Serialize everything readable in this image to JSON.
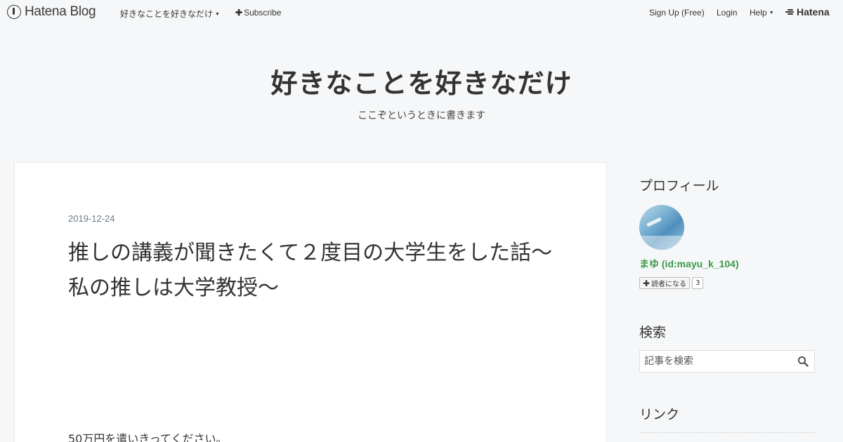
{
  "header": {
    "brand": "Hatena Blog",
    "blog_menu": "好きなことを好きなだけ",
    "subscribe": "Subscribe",
    "signup": "Sign Up (Free)",
    "login": "Login",
    "help": "Help",
    "hatena": "Hatena"
  },
  "blog": {
    "title": "好きなことを好きなだけ",
    "description": "ここぞというときに書きます"
  },
  "entry": {
    "date": "2019-12-24",
    "title": "推しの講義が聞きたくて２度目の大学生をした話～私の推しは大学教授～",
    "body_first_line": "50万円を遣いきってください。"
  },
  "sidebar": {
    "profile_title": "プロフィール",
    "profile_name": "まゆ (id:mayu_k_104)",
    "reader_button": "読者になる",
    "reader_count": "3",
    "search_title": "検索",
    "search_placeholder": "記事を検索",
    "links_title": "リンク"
  },
  "colors": {
    "page_bg": "#f6f7f8",
    "profile_name": "#3b9a4a",
    "date": "#6b7c8c"
  }
}
